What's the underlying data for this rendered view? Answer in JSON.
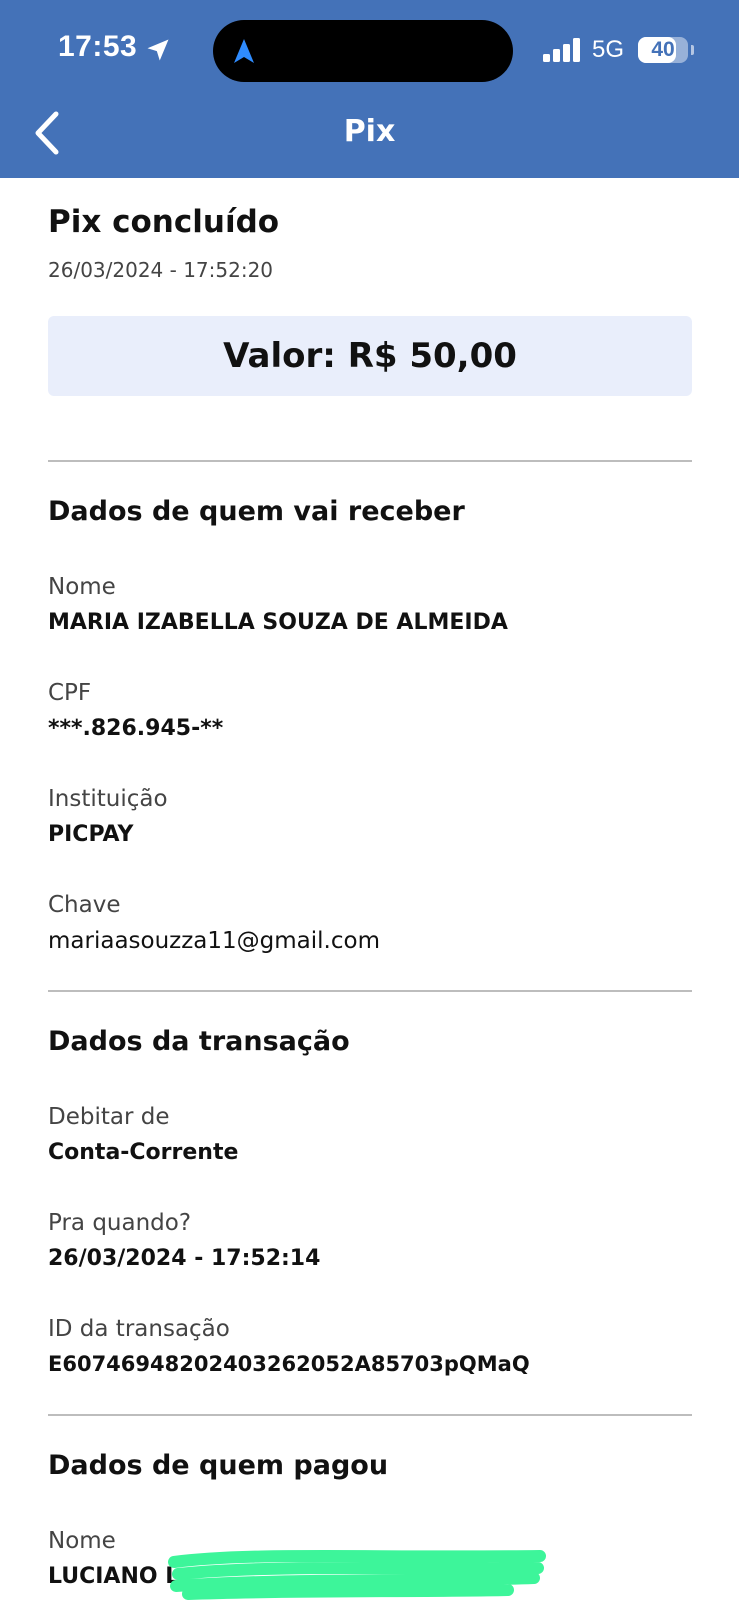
{
  "status_bar": {
    "time": "17:53",
    "network": "5G",
    "battery": "40"
  },
  "header": {
    "title": "Pix",
    "background": "#4472b8"
  },
  "icons": [
    "location-arrow-icon",
    "navigation-icon",
    "signal-icon",
    "battery-icon",
    "back-chevron-icon"
  ],
  "status": {
    "title": "Pix concluído",
    "datetime": "26/03/2024 - 17:52:20"
  },
  "amount": {
    "text": "Valor: R$ 50,00"
  },
  "recipient": {
    "title": "Dados de quem vai receber",
    "name_label": "Nome",
    "name": "MARIA IZABELLA SOUZA DE ALMEIDA",
    "cpf_label": "CPF",
    "cpf": "***.826.945-**",
    "institution_label": "Instituição",
    "institution": "PICPAY",
    "key_label": "Chave",
    "key": "mariaasouzza11@gmail.com"
  },
  "transaction": {
    "title": "Dados da transação",
    "debit_label": "Debitar de",
    "debit": "Conta-Corrente",
    "when_label": "Pra quando?",
    "when": "26/03/2024 - 17:52:14",
    "id_label": "ID da transação",
    "id": "E60746948202403262052A85703pQMaQ"
  },
  "payer": {
    "title": "Dados de quem pagou",
    "name_label": "Nome",
    "name_visible": "LUCIANO L"
  },
  "colors": {
    "accent": "#4472b8",
    "amount_box": "#e9eefb",
    "redaction": "#3df59a"
  }
}
